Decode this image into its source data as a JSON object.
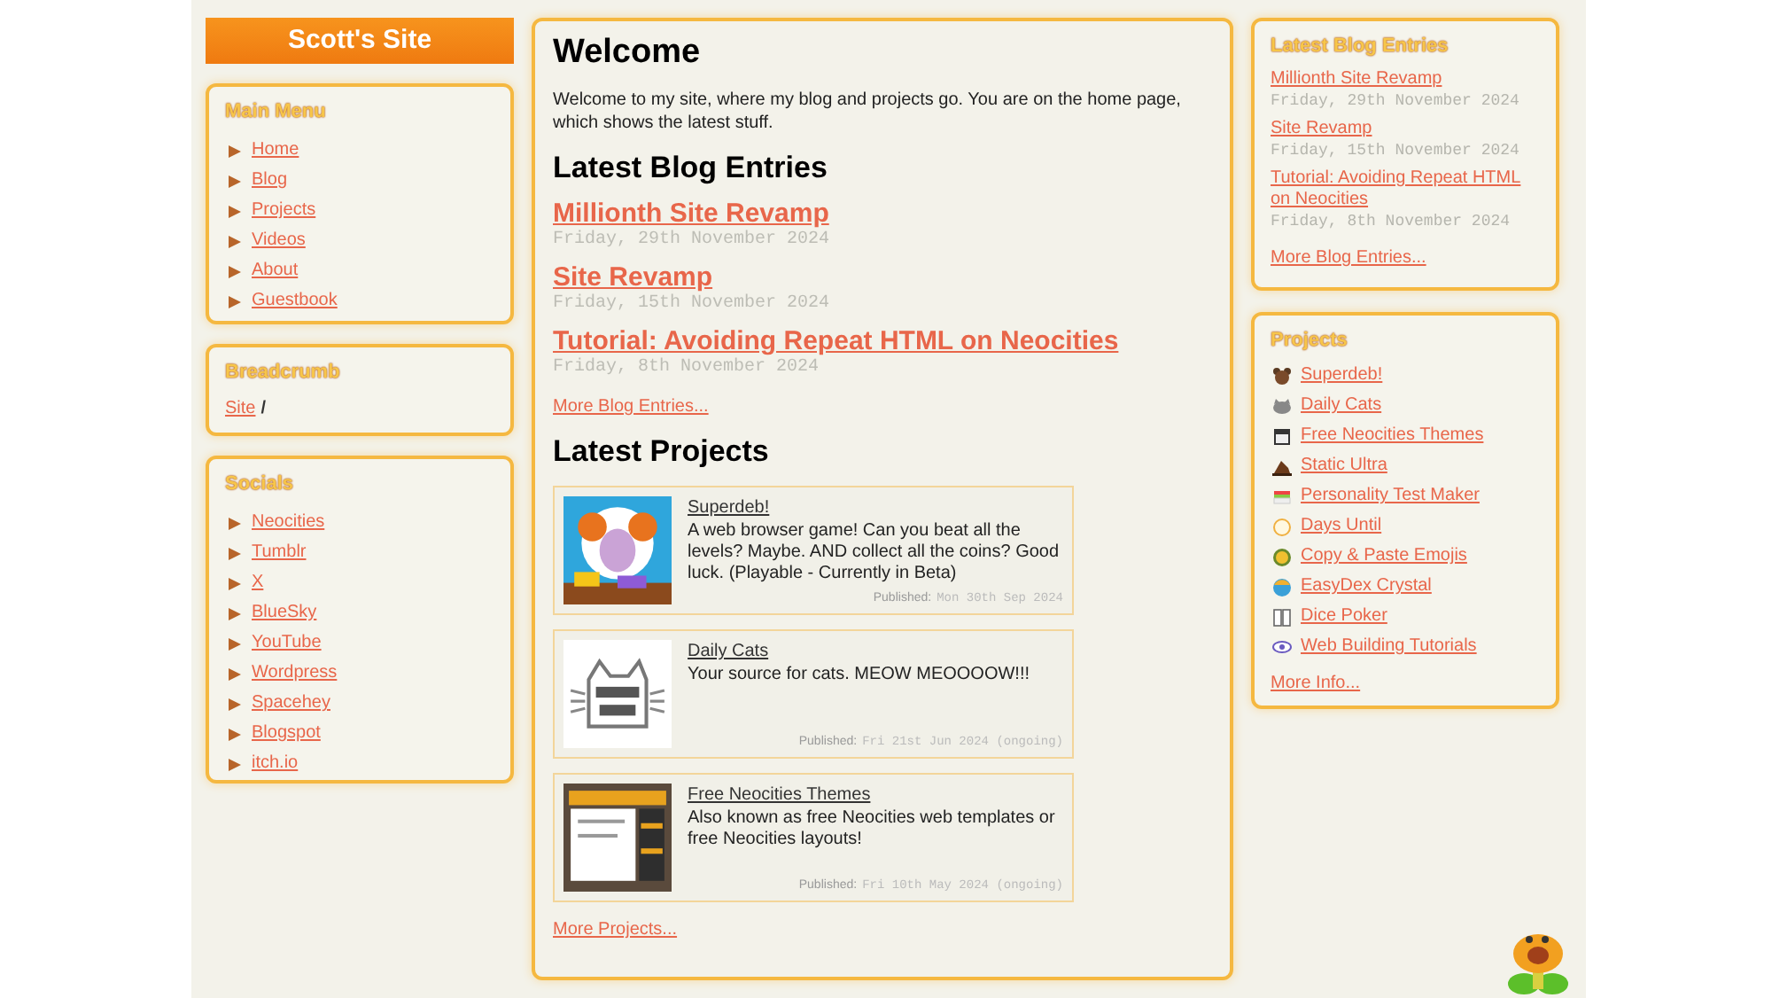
{
  "site_title": "Scott's Site",
  "main_menu": {
    "title": "Main Menu",
    "items": [
      "Home",
      "Blog",
      "Projects",
      "Videos",
      "About",
      "Guestbook"
    ]
  },
  "breadcrumb": {
    "title": "Breadcrumb",
    "link": "Site",
    "separator": "/"
  },
  "socials": {
    "title": "Socials",
    "items": [
      "Neocities",
      "Tumblr",
      "X",
      "BlueSky",
      "YouTube",
      "Wordpress",
      "Spacehey",
      "Blogspot",
      "itch.io"
    ]
  },
  "main": {
    "heading": "Welcome",
    "intro": "Welcome to my site, where my blog and projects go. You are on the home page, which shows the latest stuff.",
    "blog_heading": "Latest Blog Entries",
    "blog_entries": [
      {
        "title": "Millionth Site Revamp",
        "date": "Friday, 29th November 2024"
      },
      {
        "title": "Site Revamp",
        "date": "Friday, 15th November 2024"
      },
      {
        "title": "Tutorial: Avoiding Repeat HTML on Neocities",
        "date": "Friday, 8th November 2024"
      }
    ],
    "more_blog": "More Blog Entries...",
    "projects_heading": "Latest Projects",
    "projects": [
      {
        "title": "Superdeb!",
        "description": "A web browser game! Can you beat all the levels? Maybe. AND collect all the coins? Good luck. (Playable - Currently in Beta)",
        "published_label": "Published:",
        "published_date": "Mon 30th Sep 2024"
      },
      {
        "title": "Daily Cats",
        "description": "Your source for cats. MEOW MEOOOOW!!!",
        "published_label": "Published:",
        "published_date": "Fri 21st Jun 2024 (ongoing)"
      },
      {
        "title": "Free Neocities Themes",
        "description": "Also known as free Neocities web templates or free Neocities layouts!",
        "published_label": "Published:",
        "published_date": "Fri 10th May 2024 (ongoing)"
      }
    ],
    "more_projects": "More Projects..."
  },
  "sidebar_blog": {
    "title": "Latest Blog Entries",
    "entries": [
      {
        "title": "Millionth Site Revamp",
        "date": "Friday, 29th November 2024"
      },
      {
        "title": "Site Revamp",
        "date": "Friday, 15th November 2024"
      },
      {
        "title": "Tutorial: Avoiding Repeat HTML on Neocities",
        "date": "Friday, 8th November 2024"
      }
    ],
    "more": "More Blog Entries..."
  },
  "sidebar_projects": {
    "title": "Projects",
    "items": [
      "Superdeb!",
      "Daily Cats",
      "Free Neocities Themes",
      "Static Ultra",
      "Personality Test Maker",
      "Days Until",
      "Copy & Paste Emojis",
      "EasyDex Crystal",
      "Dice Poker",
      "Web Building Tutorials"
    ],
    "more": "More Info..."
  }
}
